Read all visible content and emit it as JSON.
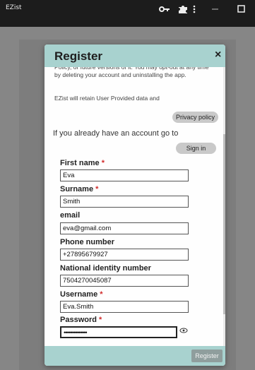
{
  "window": {
    "app_title": "EZist",
    "toolbar_icons": [
      "key-icon",
      "puzzle-icon",
      "more-vertical-icon",
      "minimize-icon",
      "maximize-icon"
    ]
  },
  "dialog": {
    "title": "Register",
    "close_label": "×",
    "policy": {
      "paragraph1": "Policy, or future versions of it. You may opt-out at any time by deleting your account and uninstalling the app.",
      "paragraph2": "EZist will retain User Provided data and"
    },
    "privacy_button": "Privacy policy",
    "account_prompt": "If you already have an account go to",
    "signin_button": "Sign in",
    "fields": {
      "first_name": {
        "label": "First name",
        "required_mark": "*",
        "value": "Eva"
      },
      "surname": {
        "label": "Surname",
        "required_mark": "*",
        "value": "Smith"
      },
      "email": {
        "label": "email",
        "value": "eva@gmail.com"
      },
      "phone": {
        "label": "Phone number",
        "value": "+27895679927"
      },
      "national_id": {
        "label": "National identity number",
        "value": "7504270045087"
      },
      "username": {
        "label": "Username",
        "required_mark": "*",
        "value": "Eva.Smith"
      },
      "password": {
        "label": "Password",
        "required_mark": "*",
        "value": "••••••••••••••"
      }
    },
    "register_button": "Register"
  },
  "colors": {
    "header_bg": "#a8d2cf",
    "required": "#d12a2a",
    "overlay": "#868686"
  }
}
